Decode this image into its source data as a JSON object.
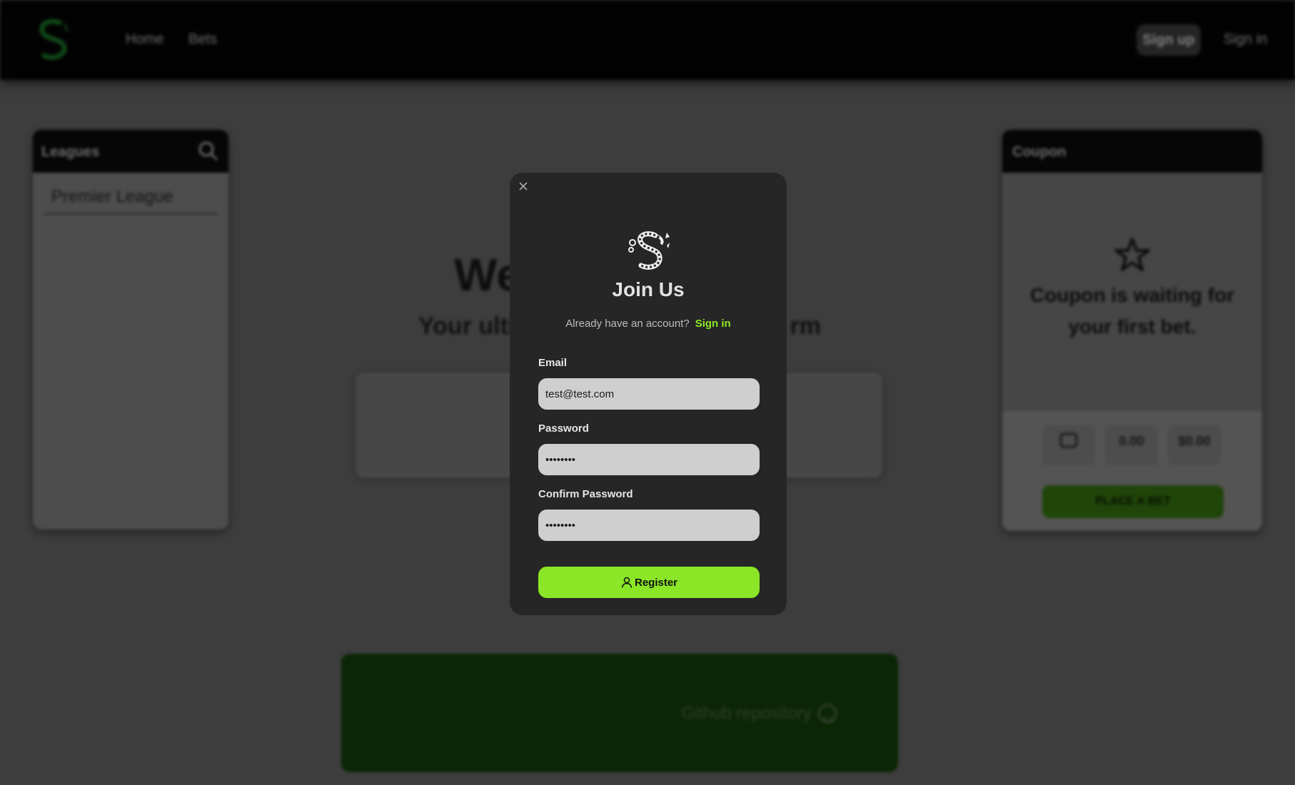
{
  "nav": {
    "home": "Home",
    "bets": "Bets",
    "signup": "Sign up",
    "signin": "Sign in"
  },
  "leagues": {
    "title": "Leagues",
    "items": [
      "Premier League"
    ]
  },
  "coupon": {
    "title": "Coupon",
    "empty_text": "Coupon is waiting for your first bet.",
    "stats": [
      {
        "label": "",
        "value": ""
      },
      {
        "label": "",
        "value": "0.00"
      },
      {
        "label": "",
        "value": "$0.00"
      }
    ],
    "place_bet": "PLACE A BET"
  },
  "footer": {
    "repo_label": "Github repository"
  },
  "modal": {
    "title": "Join Us",
    "already_text": "Already have an account?",
    "signin_link": "Sign in",
    "email_label": "Email",
    "email_value": "test@test.com",
    "password_label": "Password",
    "password_value": "••••••••",
    "confirm_label": "Confirm Password",
    "confirm_value": "••••••••",
    "register_label": "Register"
  },
  "colors": {
    "accent_green": "#8ae626",
    "modal_bg": "#262626",
    "topbar_bg": "#050505"
  }
}
